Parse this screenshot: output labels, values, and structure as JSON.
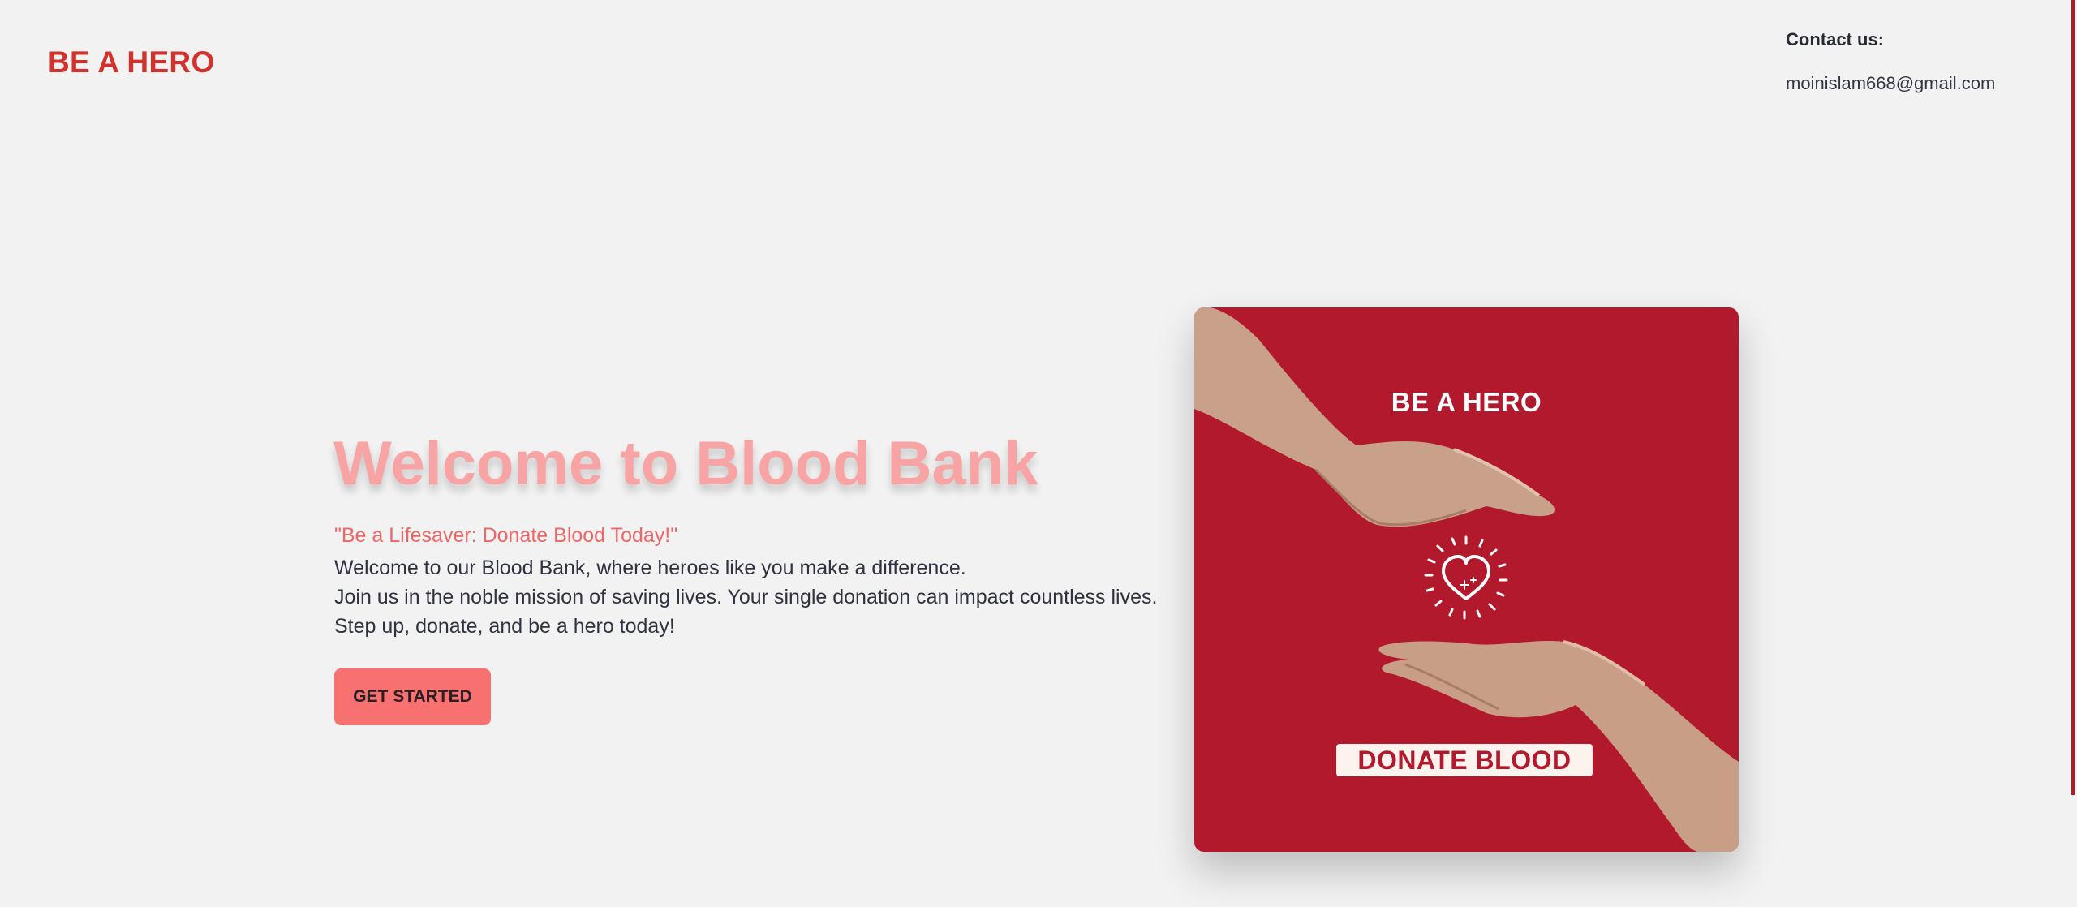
{
  "header": {
    "brand": "BE A HERO",
    "contact_title": "Contact us:",
    "contact_email": "moinislam668@gmail.com"
  },
  "hero": {
    "title": "Welcome to Blood Bank",
    "tagline": "\"Be a Lifesaver: Donate Blood Today!\"",
    "lines": [
      "Welcome to our Blood Bank, where heroes like you make a difference.",
      "Join us in the noble mission of saving lives. Your single donation can impact countless lives.",
      "Step up, donate, and be a hero today!"
    ],
    "cta_label": "GET STARTED"
  },
  "poster": {
    "title": "BE A HERO",
    "cta": "DONATE BLOOD",
    "icons": [
      "hand-icon",
      "heart-icon"
    ]
  },
  "colors": {
    "brand_red": "#d3312c",
    "poster_red": "#b3192c",
    "title_pink": "#f9a4a4",
    "tagline": "#ee6666",
    "button": "#f87171",
    "background": "#f2f2f2"
  }
}
